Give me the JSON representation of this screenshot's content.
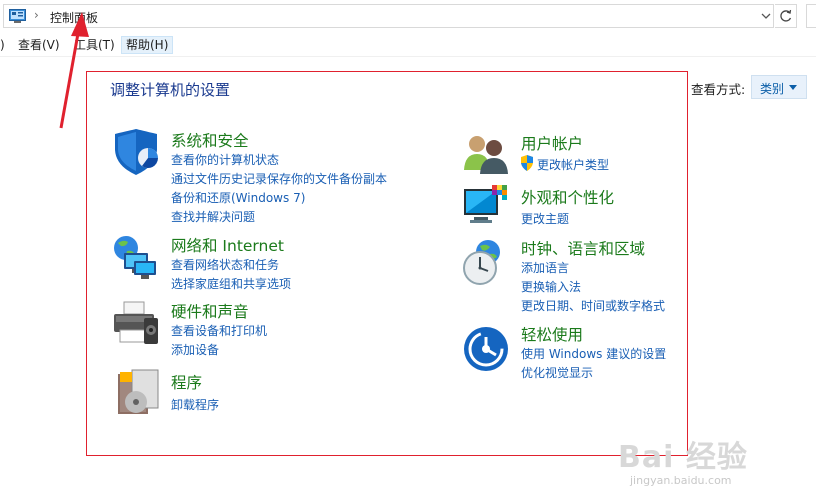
{
  "address": {
    "separator": "›",
    "path": "控制面板"
  },
  "menu": {
    "fragment": ")",
    "view": "查看(V)",
    "tools": "工具(T)",
    "help": "帮助(H)"
  },
  "view_by": {
    "label": "查看方式:",
    "value": "类别"
  },
  "page_title": "调整计算机的设置",
  "categories": [
    {
      "title": "系统和安全",
      "icon": "shield-icon",
      "links": [
        "查看你的计算机状态",
        "通过文件历史记录保存你的文件备份副本",
        "备份和还原(Windows 7)",
        "查找并解决问题"
      ]
    },
    {
      "title": "网络和 Internet",
      "icon": "network-icon",
      "links": [
        "查看网络状态和任务",
        "选择家庭组和共享选项"
      ]
    },
    {
      "title": "硬件和声音",
      "icon": "printer-icon",
      "links": [
        "查看设备和打印机",
        "添加设备"
      ]
    },
    {
      "title": "程序",
      "icon": "programs-icon",
      "links": [
        "卸载程序"
      ]
    },
    {
      "title": "用户帐户",
      "icon": "users-icon",
      "links": [
        "更改帐户类型"
      ]
    },
    {
      "title": "外观和个性化",
      "icon": "monitor-icon",
      "links": [
        "更改主题"
      ]
    },
    {
      "title": "时钟、语言和区域",
      "icon": "clock-globe-icon",
      "links": [
        "添加语言",
        "更换输入法",
        "更改日期、时间或数字格式"
      ]
    },
    {
      "title": "轻松使用",
      "icon": "ease-of-access-icon",
      "links": [
        "使用 Windows 建议的设置",
        "优化视觉显示"
      ]
    }
  ],
  "watermark": {
    "brand": "Bai 经验",
    "url": "jingyan.baidu.com"
  },
  "colors": {
    "title_blue": "#1a3a8f",
    "category_green": "#1b7a1b",
    "link_blue": "#1a5fb4",
    "annotation_red": "#e0212e"
  }
}
